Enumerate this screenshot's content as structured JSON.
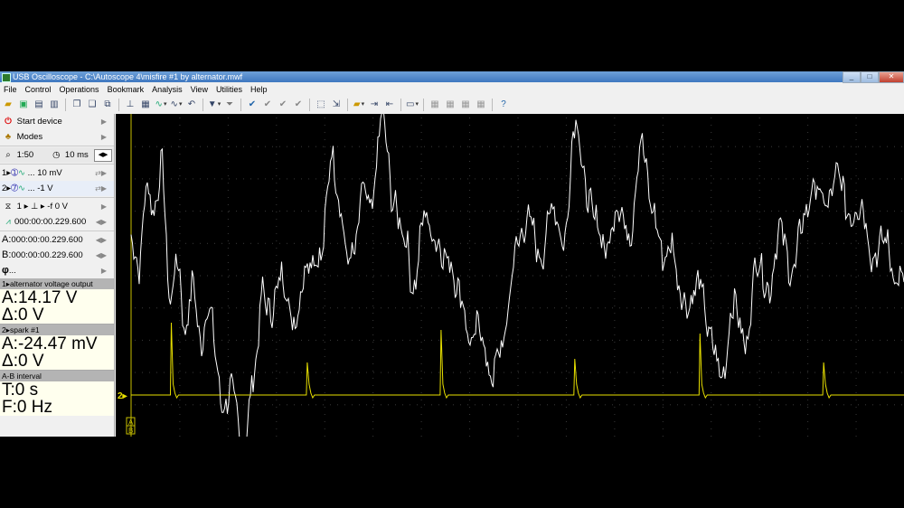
{
  "window": {
    "title": "USB Oscilloscope - C:\\Autoscope 4\\misfire #1 by alternator.mwf",
    "controls": [
      "_",
      "□",
      "✕"
    ]
  },
  "menu": [
    "File",
    "Control",
    "Operations",
    "Bookmark",
    "Analysis",
    "View",
    "Utilities",
    "Help"
  ],
  "sidebar": {
    "start_device": "Start device",
    "modes": "Modes",
    "zoom": "1:50",
    "timebase": "10 ms",
    "ch1_scale": "... 10 mV",
    "ch2_scale": "... -1 V",
    "trigger": "1 ▸ ⊥ ▸ -f 0 V",
    "trigger_time": "000:00:00.229.600",
    "cursor_a_time": "000:00:00.229.600",
    "cursor_b_time": "000:00:00.229.600",
    "phi": "...",
    "ch1_prefix": "1▸",
    "ch2_prefix": "2▸",
    "a_label": "A:",
    "b_label": "B:",
    "phi_label": "φ"
  },
  "measurements": {
    "ch1_name": "1▸alternator voltage output",
    "ch1_a": "A:14.17 V",
    "ch1_delta": "Δ:0 V",
    "ch2_name": "2▸spark #1",
    "ch2_a": "A:-24.47 mV",
    "ch2_delta": "Δ:0 V",
    "ab_name": "A-B interval",
    "ab_t": "T:0 s",
    "ab_f": "F:0 Hz"
  },
  "scope": {
    "ch2_marker": "2▸",
    "cursor_a": "A",
    "cursor_b": "B",
    "colors": {
      "background": "#000000",
      "grid": "#3a3a3a",
      "ch1": "#ffffff",
      "ch2": "#e8e000",
      "cursor": "#c8c000"
    }
  },
  "chart_data": {
    "type": "line",
    "series": [
      {
        "name": "alternator voltage output",
        "color": "#ffffff",
        "points": [
          [
            0,
            0.62
          ],
          [
            0.01,
            0.52
          ],
          [
            0.02,
            0.78
          ],
          [
            0.03,
            0.7
          ],
          [
            0.04,
            0.85
          ],
          [
            0.05,
            0.42
          ],
          [
            0.06,
            0.55
          ],
          [
            0.07,
            0.32
          ],
          [
            0.08,
            0.48
          ],
          [
            0.09,
            0.28
          ],
          [
            0.1,
            0.4
          ],
          [
            0.12,
            0.08
          ],
          [
            0.13,
            0.15
          ],
          [
            0.145,
            -0.05
          ],
          [
            0.16,
            0.2
          ],
          [
            0.17,
            0.45
          ],
          [
            0.18,
            0.38
          ],
          [
            0.195,
            0.5
          ],
          [
            0.21,
            0.35
          ],
          [
            0.23,
            0.55
          ],
          [
            0.245,
            0.55
          ],
          [
            0.26,
            0.88
          ],
          [
            0.27,
            0.72
          ],
          [
            0.28,
            0.55
          ],
          [
            0.29,
            0.58
          ],
          [
            0.3,
            0.78
          ],
          [
            0.31,
            0.7
          ],
          [
            0.325,
            1.0
          ],
          [
            0.34,
            0.72
          ],
          [
            0.355,
            0.62
          ],
          [
            0.365,
            0.45
          ],
          [
            0.38,
            0.7
          ],
          [
            0.39,
            0.62
          ],
          [
            0.41,
            0.55
          ],
          [
            0.425,
            0.45
          ],
          [
            0.44,
            0.28
          ],
          [
            0.45,
            0.35
          ],
          [
            0.465,
            0.18
          ],
          [
            0.48,
            0.28
          ],
          [
            0.5,
            0.6
          ],
          [
            0.515,
            0.68
          ],
          [
            0.53,
            0.55
          ],
          [
            0.545,
            0.72
          ],
          [
            0.56,
            0.6
          ],
          [
            0.575,
            0.99
          ],
          [
            0.59,
            0.75
          ],
          [
            0.6,
            0.68
          ],
          [
            0.615,
            0.58
          ],
          [
            0.63,
            0.72
          ],
          [
            0.645,
            0.62
          ],
          [
            0.66,
            0.92
          ],
          [
            0.675,
            0.7
          ],
          [
            0.69,
            0.55
          ],
          [
            0.7,
            0.6
          ],
          [
            0.71,
            0.45
          ],
          [
            0.72,
            0.4
          ],
          [
            0.735,
            0.48
          ],
          [
            0.75,
            0.3
          ],
          [
            0.765,
            0.18
          ],
          [
            0.78,
            0.42
          ],
          [
            0.795,
            0.28
          ],
          [
            0.81,
            0.55
          ],
          [
            0.825,
            0.45
          ],
          [
            0.84,
            0.65
          ],
          [
            0.855,
            0.5
          ],
          [
            0.87,
            0.68
          ],
          [
            0.885,
            0.78
          ],
          [
            0.9,
            0.72
          ],
          [
            0.915,
            0.82
          ],
          [
            0.93,
            0.68
          ],
          [
            0.945,
            0.72
          ],
          [
            0.96,
            0.55
          ],
          [
            0.975,
            0.62
          ],
          [
            0.99,
            0.48
          ],
          [
            1.0,
            0.5
          ]
        ]
      },
      {
        "name": "spark #1",
        "color": "#e8e000",
        "spikes": [
          0.052,
          0.228,
          0.401,
          0.574,
          0.736,
          0.896
        ],
        "spike_heights": [
          1.0,
          0.45,
          0.9,
          0.5,
          0.85,
          0.45
        ]
      }
    ]
  }
}
